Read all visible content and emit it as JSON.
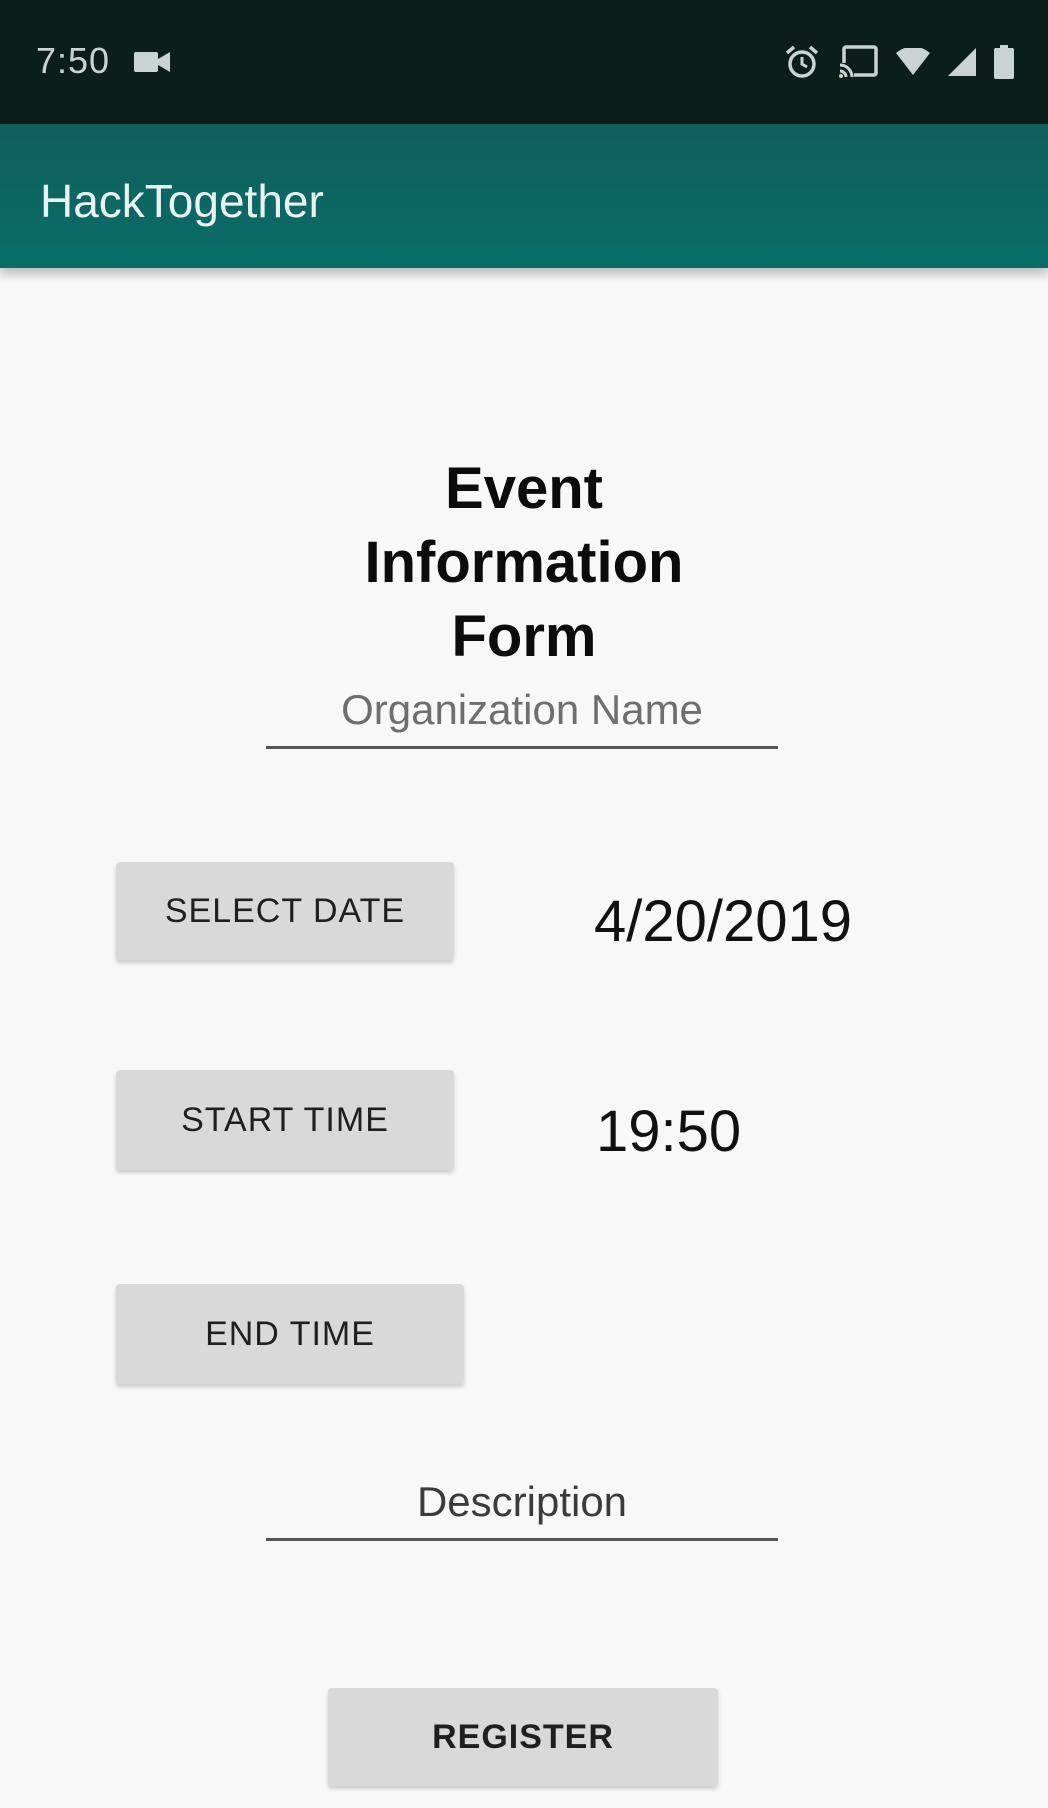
{
  "status_bar": {
    "time": "7:50",
    "icons": [
      "camera-icon",
      "alarm-icon",
      "cast-icon",
      "wifi-icon",
      "signal-icon",
      "battery-icon"
    ]
  },
  "app_bar": {
    "title": "HackTogether",
    "color": "#0a6d68"
  },
  "form": {
    "title": "Event Information Form",
    "organization_placeholder": "Organization Name",
    "select_date_label": "SELECT DATE",
    "date_value": "4/20/2019",
    "start_time_label": "START TIME",
    "start_time_value": "19:50",
    "end_time_label": "END TIME",
    "description_placeholder": "Description",
    "register_label": "REGISTER"
  }
}
